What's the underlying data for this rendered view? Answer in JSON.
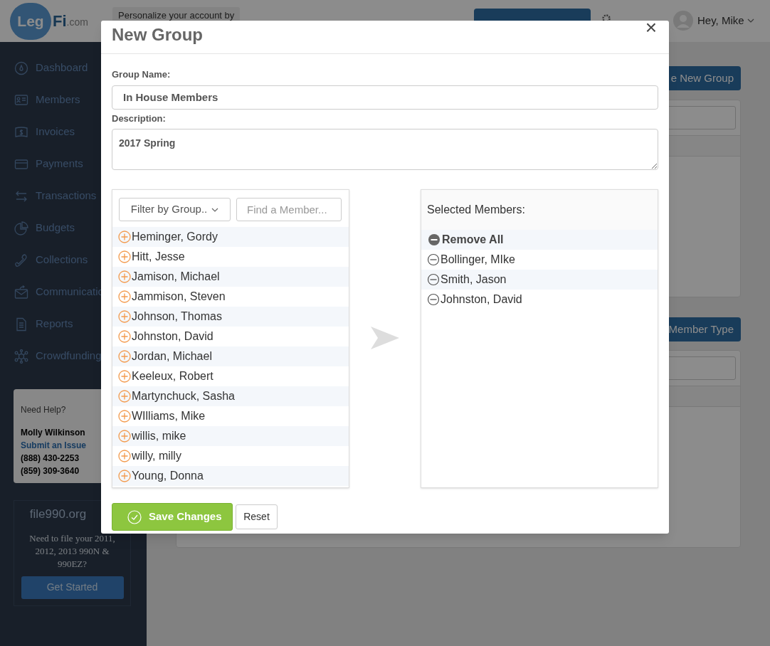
{
  "header": {
    "logo": [
      "Leg",
      "Fi",
      ".com"
    ],
    "personalize": "Personalize your account by",
    "user": "Hey, Mike"
  },
  "sidebar": {
    "items": [
      {
        "label": "Dashboard"
      },
      {
        "label": "Members"
      },
      {
        "label": "Invoices"
      },
      {
        "label": "Payments"
      },
      {
        "label": "Transactions"
      },
      {
        "label": "Budgets"
      },
      {
        "label": "Collections"
      },
      {
        "label": "Communicatio"
      },
      {
        "label": "Reports"
      },
      {
        "label": "Crowdfunding"
      }
    ],
    "help": {
      "title": "Need Help?",
      "name": "Molly Wilkinson",
      "link": "Submit an Issue",
      "phones": [
        "(888) 430-2253",
        "(859) 309-3640"
      ]
    },
    "promo": {
      "title": "file990.org",
      "text": "Need to file your 2011, 2012, 2013 990N & 990EZ?",
      "button": "Get Started"
    }
  },
  "main": {
    "buttons": [
      "e New Group",
      "Member Type"
    ]
  },
  "modal": {
    "title": "New Group",
    "group_name_label": "Group Name:",
    "group_name": "In House Members",
    "description_label": "Description:",
    "description": "2017 Spring",
    "filter": "Filter by Group..",
    "find_placeholder": "Find a Member...",
    "available": [
      "Heminger, Gordy",
      "Hitt, Jesse",
      "Jamison, Michael",
      "Jammison, Steven",
      "Johnson, Thomas",
      "Johnston, David",
      "Jordan, Michael",
      "Keeleux, Robert",
      "Martynchuck, Sasha",
      "WIlliams, Mike",
      "willis, mike",
      "willy, milly",
      "Young, Donna"
    ],
    "selected_title": "Selected Members:",
    "remove_all": "Remove All",
    "selected": [
      "Bollinger, MIke",
      "Smith, Jason",
      "Johnston, David"
    ],
    "save": "Save Changes",
    "reset": "Reset",
    "close": "×"
  }
}
